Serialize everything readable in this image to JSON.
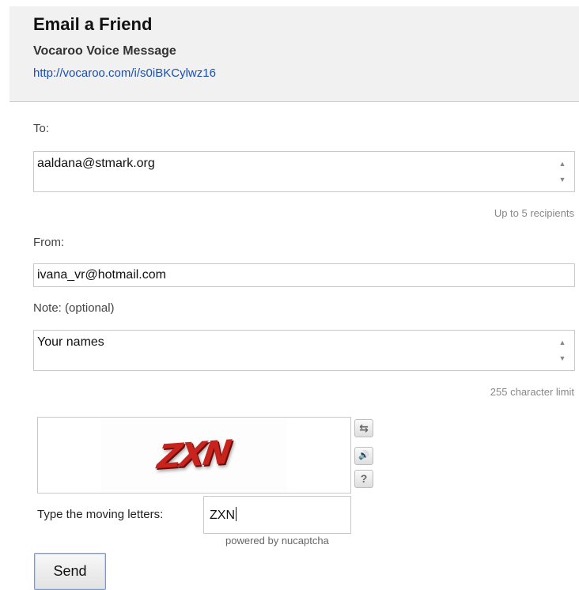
{
  "header": {
    "title": "Email a Friend",
    "subtitle": "Vocaroo Voice Message",
    "link": "http://vocaroo.com/i/s0iBKCylwz16"
  },
  "to": {
    "label": "To:",
    "value": "aaldana@stmark.org",
    "hint": "Up to 5 recipients"
  },
  "from": {
    "label": "From:",
    "value": "ivana_vr@hotmail.com"
  },
  "note": {
    "label": "Note: (optional)",
    "value": "Your names",
    "hint": "255 character limit"
  },
  "captcha": {
    "image_text": "ZXN",
    "prompt": "Type the moving letters:",
    "input_value": "ZXN",
    "powered_by": "powered by nucaptcha",
    "buttons": {
      "refresh_glyph": "⇆",
      "audio_glyph": "🔊",
      "help_glyph": "?"
    }
  },
  "send_label": "Send"
}
